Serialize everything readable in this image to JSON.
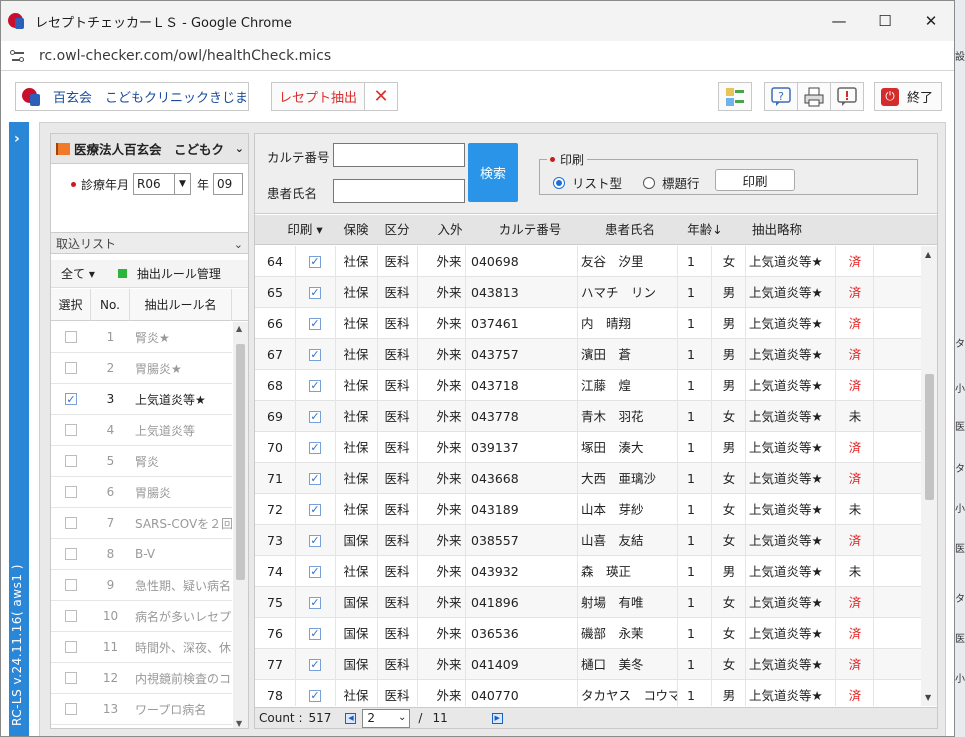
{
  "window": {
    "title": "レセプトチェッカーＬＳ - Google Chrome",
    "minimize": "—",
    "maximize": "☐",
    "close": "✕",
    "url": "rc.owl-checker.com/owl/healthCheck.mics"
  },
  "toolbar": {
    "clinic_label": "百玄会　こどもクリニックきじま",
    "extract_label": "レセプト抽出",
    "end_label": "終了"
  },
  "sidebar": {
    "version": "RC-LS v.24.11.16( aws1 )"
  },
  "left": {
    "header": "医療法人百玄会　こどもク",
    "date_label": "診療年月",
    "year_value": "R06",
    "year_suffix": "年",
    "month_value": "09",
    "torilist": "取込リスト",
    "all_label": "全て",
    "rule_manage": "抽出ルール管理",
    "col_select": "選択",
    "col_no": "No.",
    "col_rule": "抽出ルール名",
    "rules": [
      {
        "no": "1",
        "name": "腎炎★",
        "checked": false
      },
      {
        "no": "2",
        "name": "胃腸炎★",
        "checked": false
      },
      {
        "no": "3",
        "name": "上気道炎等★",
        "checked": true
      },
      {
        "no": "4",
        "name": "上気道炎等",
        "checked": false
      },
      {
        "no": "5",
        "name": "腎炎",
        "checked": false
      },
      {
        "no": "6",
        "name": "胃腸炎",
        "checked": false
      },
      {
        "no": "7",
        "name": "SARS-COVを２回",
        "checked": false
      },
      {
        "no": "8",
        "name": "B-V",
        "checked": false
      },
      {
        "no": "9",
        "name": "急性期、疑い病名の",
        "checked": false
      },
      {
        "no": "10",
        "name": "病名が多いレセプト",
        "checked": false
      },
      {
        "no": "11",
        "name": "時間外、深夜、休日",
        "checked": false
      },
      {
        "no": "12",
        "name": "内視鏡前検査のコメ",
        "checked": false
      },
      {
        "no": "13",
        "name": "ワープロ病名",
        "checked": false
      }
    ]
  },
  "search": {
    "karte_label": "カルテ番号",
    "name_label": "患者氏名",
    "karte_value": "",
    "name_value": "",
    "search_button": "検索",
    "print_group": "印刷",
    "radio_list": "リスト型",
    "radio_title": "標題行",
    "print_button": "印刷"
  },
  "table": {
    "headers": {
      "print": "印刷",
      "insurance": "保険",
      "division": "区分",
      "inout": "入外",
      "karte": "カルテ番号",
      "name": "患者氏名",
      "age": "年齢↓",
      "rule": "抽出略称"
    },
    "rows": [
      {
        "no": "64",
        "ins": "社保",
        "div": "医科",
        "io": "外来",
        "karte": "040698",
        "name": "友谷　汐里",
        "age": "1",
        "sex": "女",
        "rule": "上気道炎等★",
        "status": "済"
      },
      {
        "no": "65",
        "ins": "社保",
        "div": "医科",
        "io": "外来",
        "karte": "043813",
        "name": "ハマチ　リン",
        "age": "1",
        "sex": "男",
        "rule": "上気道炎等★",
        "status": "済"
      },
      {
        "no": "66",
        "ins": "社保",
        "div": "医科",
        "io": "外来",
        "karte": "037461",
        "name": "内　晴翔",
        "age": "1",
        "sex": "男",
        "rule": "上気道炎等★",
        "status": "済"
      },
      {
        "no": "67",
        "ins": "社保",
        "div": "医科",
        "io": "外来",
        "karte": "043757",
        "name": "濱田　蒼",
        "age": "1",
        "sex": "男",
        "rule": "上気道炎等★",
        "status": "済"
      },
      {
        "no": "68",
        "ins": "社保",
        "div": "医科",
        "io": "外来",
        "karte": "043718",
        "name": "江藤　煌",
        "age": "1",
        "sex": "男",
        "rule": "上気道炎等★",
        "status": "済"
      },
      {
        "no": "69",
        "ins": "社保",
        "div": "医科",
        "io": "外来",
        "karte": "043778",
        "name": "青木　羽花",
        "age": "1",
        "sex": "女",
        "rule": "上気道炎等★",
        "status": "未"
      },
      {
        "no": "70",
        "ins": "社保",
        "div": "医科",
        "io": "外来",
        "karte": "039137",
        "name": "塚田　湊大",
        "age": "1",
        "sex": "男",
        "rule": "上気道炎等★",
        "status": "済"
      },
      {
        "no": "71",
        "ins": "社保",
        "div": "医科",
        "io": "外来",
        "karte": "043668",
        "name": "大西　亜璃沙",
        "age": "1",
        "sex": "女",
        "rule": "上気道炎等★",
        "status": "済"
      },
      {
        "no": "72",
        "ins": "社保",
        "div": "医科",
        "io": "外来",
        "karte": "043189",
        "name": "山本　芽紗",
        "age": "1",
        "sex": "女",
        "rule": "上気道炎等★",
        "status": "未"
      },
      {
        "no": "73",
        "ins": "国保",
        "div": "医科",
        "io": "外来",
        "karte": "038557",
        "name": "山喜　友結",
        "age": "1",
        "sex": "女",
        "rule": "上気道炎等★",
        "status": "済"
      },
      {
        "no": "74",
        "ins": "社保",
        "div": "医科",
        "io": "外来",
        "karte": "043932",
        "name": "森　瑛正",
        "age": "1",
        "sex": "男",
        "rule": "上気道炎等★",
        "status": "未"
      },
      {
        "no": "75",
        "ins": "国保",
        "div": "医科",
        "io": "外来",
        "karte": "041896",
        "name": "射場　有唯",
        "age": "1",
        "sex": "女",
        "rule": "上気道炎等★",
        "status": "済"
      },
      {
        "no": "76",
        "ins": "国保",
        "div": "医科",
        "io": "外来",
        "karte": "036536",
        "name": "磯部　永茉",
        "age": "1",
        "sex": "女",
        "rule": "上気道炎等★",
        "status": "済"
      },
      {
        "no": "77",
        "ins": "国保",
        "div": "医科",
        "io": "外来",
        "karte": "041409",
        "name": "樋口　美冬",
        "age": "1",
        "sex": "女",
        "rule": "上気道炎等★",
        "status": "済"
      },
      {
        "no": "78",
        "ins": "社保",
        "div": "医科",
        "io": "外来",
        "karte": "040770",
        "name": "タカヤス　コウマ",
        "age": "1",
        "sex": "男",
        "rule": "上気道炎等★",
        "status": "済"
      }
    ]
  },
  "footer": {
    "count_label": "Count :",
    "count": "517",
    "page": "2",
    "separator": "/",
    "total_pages": "11"
  },
  "colors": {
    "accent": "#2a95e8",
    "sidebar": "#2a86d6",
    "status_done": "#e02020"
  }
}
